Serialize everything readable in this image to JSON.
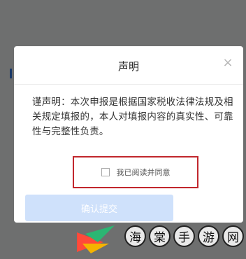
{
  "dialog": {
    "title": "声明",
    "statement": "谨声明：本次申报是根据国家税收法律法规及相关规定填报的，本人对填报内容的真实性、可靠性与完整性负责。",
    "agree_label": "我已阅读并同意",
    "confirm_label": "确认提交"
  },
  "colors": {
    "highlight": "#c1272d",
    "primary_disabled": "#cfe1fb"
  },
  "watermark": {
    "text": "海棠手游网"
  },
  "icons": {
    "close": "close-icon",
    "checkbox": "checkbox-icon"
  }
}
